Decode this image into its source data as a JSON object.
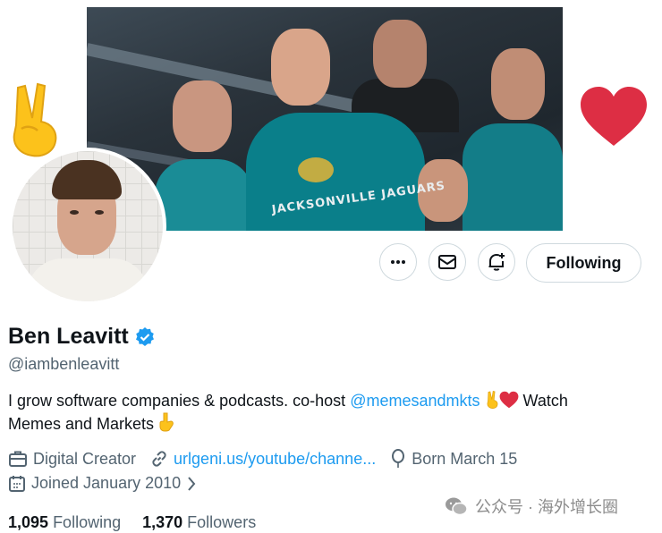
{
  "profile": {
    "name": "Ben Leavitt",
    "handle": "@iambenleavitt",
    "bio": {
      "part1": "I grow software companies & podcasts. co-host ",
      "mention": "@memesandmkts",
      "part2": " Watch",
      "part3": "Memes and Markets"
    },
    "category": "Digital Creator",
    "website": "urlgeni.us/youtube/channe...",
    "birthday": "Born March 15",
    "joined": "Joined January 2010",
    "following_count": "1,095",
    "following_label": "Following",
    "followers_count": "1,370",
    "followers_label": "Followers"
  },
  "actions": {
    "follow_label": "Following"
  },
  "banner": {
    "jersey_text": "JACKSONVILLE JAGUARS"
  },
  "watermark": {
    "text": "公众号 · 海外增长圈"
  },
  "icons": [
    "peace-hand-icon",
    "heart-icon",
    "more-icon",
    "mail-icon",
    "notification-add-icon",
    "verified-badge-icon",
    "briefcase-icon",
    "link-icon",
    "balloon-icon",
    "calendar-icon",
    "chevron-right-icon",
    "point-down-icon",
    "wechat-icon"
  ],
  "colors": {
    "link": "#1d9bf0",
    "text": "#0f1419",
    "secondary": "#536471",
    "border": "#cfd9de",
    "heart": "#e0243c"
  }
}
